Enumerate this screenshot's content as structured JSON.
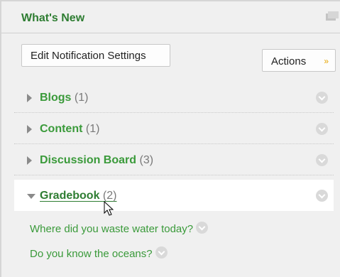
{
  "header": {
    "title": "What's New",
    "collapse_icon": "window-collapse-icon"
  },
  "toolbar": {
    "edit_label": "Edit Notification Settings",
    "actions_label": "Actions",
    "actions_icon": "double-chevron-down-icon"
  },
  "sections": [
    {
      "label": "Blogs",
      "count": "(1)",
      "expanded": false
    },
    {
      "label": "Content",
      "count": "(1)",
      "expanded": false
    },
    {
      "label": "Discussion Board",
      "count": "(3)",
      "expanded": false
    },
    {
      "label": "Gradebook",
      "count": "(2)",
      "expanded": true
    }
  ],
  "gradebook_items": [
    "Where did you waste water today?",
    "Do you know the oceans?"
  ],
  "colors": {
    "accent_green": "#3a9a3a",
    "title_green": "#2e7d32",
    "chevron_gold": "#e6a500"
  }
}
